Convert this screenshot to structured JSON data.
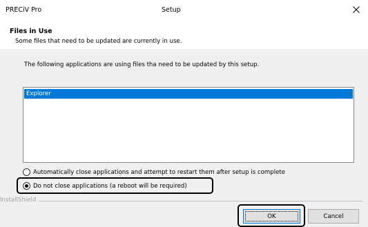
{
  "window": {
    "app_name": "PRECiV Pro",
    "title": "Setup",
    "close_glyph": "✕"
  },
  "header": {
    "title": "Files in Use",
    "subtitle": "Some files that need to be updated are currently in use."
  },
  "body": {
    "description": "The following applications are using files tha need to be updated by this setup.",
    "applications": [
      {
        "name": "Explorer",
        "selected": true
      }
    ]
  },
  "options": {
    "auto_close_label": "Automatically close applications and attempt to restart them after setup is complete",
    "no_close_label": "Do not close applications (a reboot will be required)",
    "selected": "no_close"
  },
  "footer": {
    "brand": "InstallShield",
    "ok_label": "OK",
    "cancel_label": "Cancel"
  },
  "colors": {
    "selection": "#0078d7",
    "dialog_bg": "#f0f0f0",
    "highlight_outline": "#000000"
  }
}
